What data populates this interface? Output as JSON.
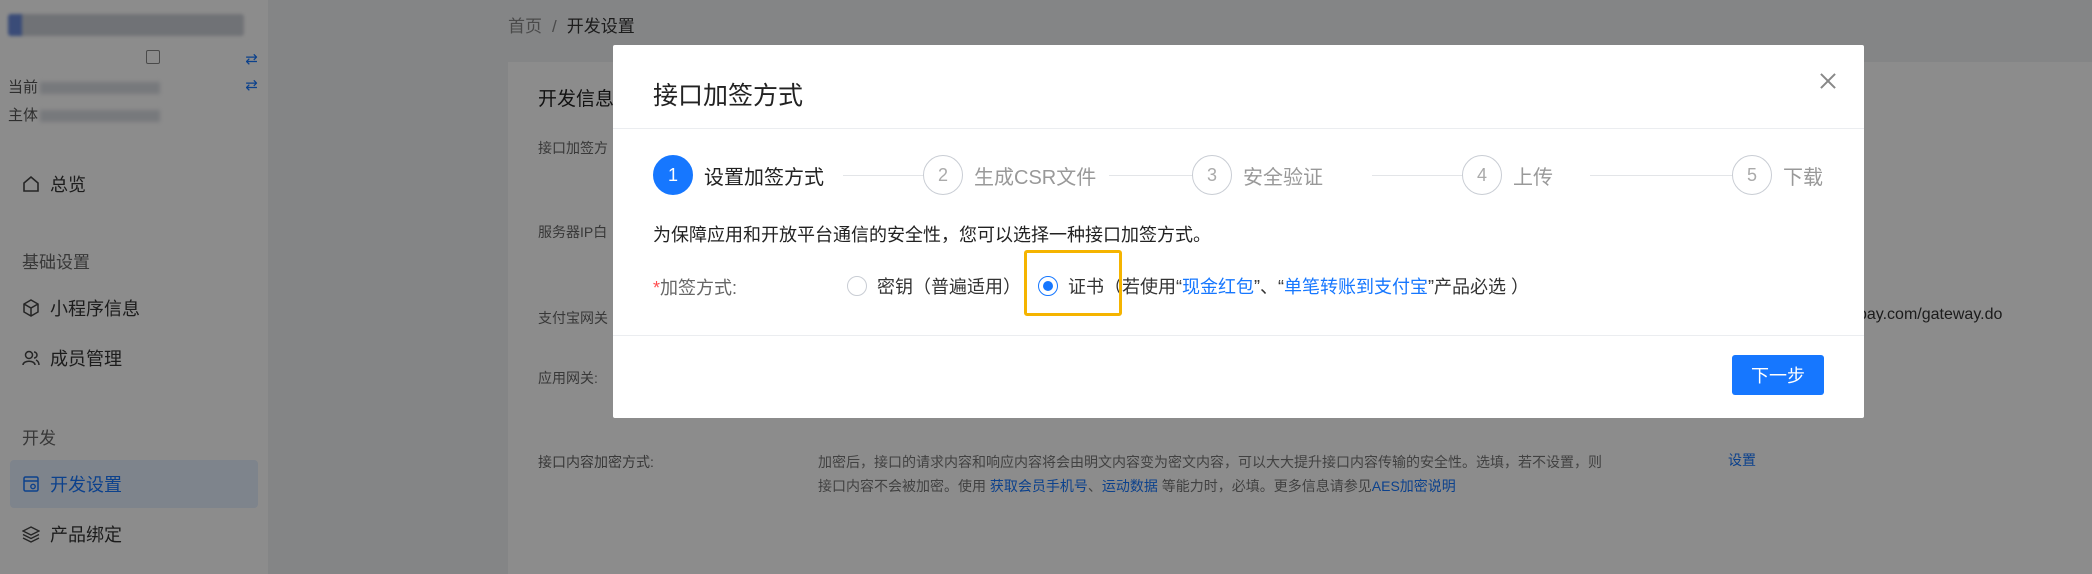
{
  "sidebar": {
    "current_prefix": "当前",
    "subject_prefix": "主体",
    "nav": {
      "overview": "总览",
      "group_basic": "基础设置",
      "miniapp_info": "小程序信息",
      "member_mgmt": "成员管理",
      "group_dev": "开发",
      "dev_settings": "开发设置",
      "product_binding": "产品绑定"
    },
    "icons": {
      "overview": "home-icon",
      "miniapp_info": "cube-icon",
      "member_mgmt": "users-icon",
      "dev_settings": "settings-file-icon",
      "product_binding": "layers-icon",
      "swap": "swap-icon",
      "copy": "copy-icon"
    }
  },
  "breadcrumb": {
    "home": "首页",
    "separator": "/",
    "current": "开发设置"
  },
  "card": {
    "title": "开发信息",
    "labels": {
      "sign_method": "接口加签方",
      "server_ip": "服务器IP白",
      "alipay_gateway": "支付宝网关",
      "app_gateway": "应用网关:",
      "content_encrypt": "接口内容加密方式:"
    },
    "gateway_value": "pay.com/gateway.do",
    "encrypt_desc_1": "加密后，接口的请求内容和响应内容将会由明文内容变为密文内容，可以大大提升接口内容传输的安全性。选填，若不设置，则",
    "encrypt_desc_2_pre": "接口内容不会被加密。使用",
    "encrypt_link_phone": "获取会员手机号",
    "encrypt_sep": "、",
    "encrypt_link_sport": "运动数据",
    "encrypt_desc_2_mid": "等能力时，必填。更多信息请参见",
    "encrypt_link_aes": "AES加密说明",
    "set_link": "设置"
  },
  "modal": {
    "title": "接口加签方式",
    "steps": [
      {
        "num": "1",
        "label": "设置加签方式",
        "active": true
      },
      {
        "num": "2",
        "label": "生成CSR文件",
        "active": false
      },
      {
        "num": "3",
        "label": "安全验证",
        "active": false
      },
      {
        "num": "4",
        "label": "上传",
        "active": false
      },
      {
        "num": "5",
        "label": "下载",
        "active": false
      }
    ],
    "description": "为保障应用和开放平台通信的安全性，您可以选择一种接口加签方式。",
    "form": {
      "required_mark": "*",
      "label": "加签方式:",
      "options": [
        {
          "label": "密钥（普遍适用）",
          "checked": false
        },
        {
          "label_pre": "证书（若使用“",
          "link1": "现金红包",
          "mid": "”、“",
          "link2": "单笔转账到支付宝",
          "label_post": "”产品必选 ）",
          "checked": true
        }
      ]
    },
    "next_button": "下一步",
    "colors": {
      "primary": "#1677ff",
      "highlight": "#f5b400",
      "required": "#ff4d4f"
    }
  }
}
